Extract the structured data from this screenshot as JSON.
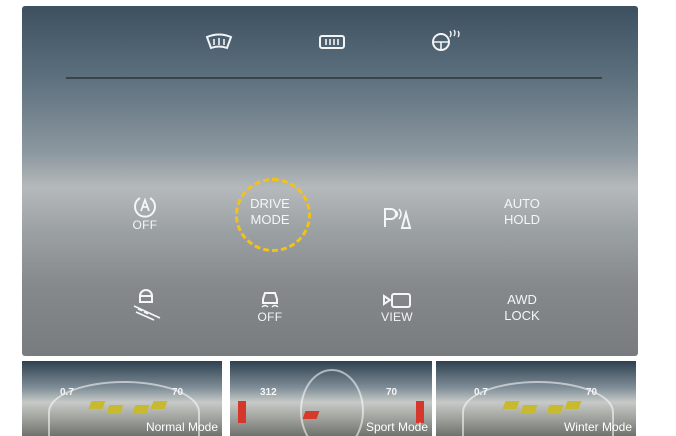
{
  "controls": {
    "drive_mode": {
      "line1": "DRIVE",
      "line2": "MODE"
    },
    "auto_hold": {
      "line1": "AUTO",
      "line2": "HOLD"
    },
    "awd_lock": {
      "line1": "AWD",
      "line2": "LOCK"
    },
    "isg_off": "OFF",
    "esc_off": "OFF",
    "camera_view": "VIEW"
  },
  "thumbnails": [
    {
      "caption": "Normal Mode",
      "left_value": "0.7",
      "right_value": "70"
    },
    {
      "caption": "Sport Mode",
      "left_value": "312",
      "right_value": "70"
    },
    {
      "caption": "Winter Mode",
      "left_value": "0.7",
      "right_value": "70"
    }
  ],
  "colors": {
    "highlight": "#f2c21a",
    "divider": "#39434b",
    "sport_accent": "#d63b2a",
    "eco_accent": "#c8ba2e"
  },
  "icons": [
    "front-defrost-icon",
    "rear-defrost-icon",
    "heated-steering-icon",
    "isg-icon",
    "parking-sensor-icon",
    "hill-descent-icon",
    "esc-icon",
    "camera-icon"
  ]
}
